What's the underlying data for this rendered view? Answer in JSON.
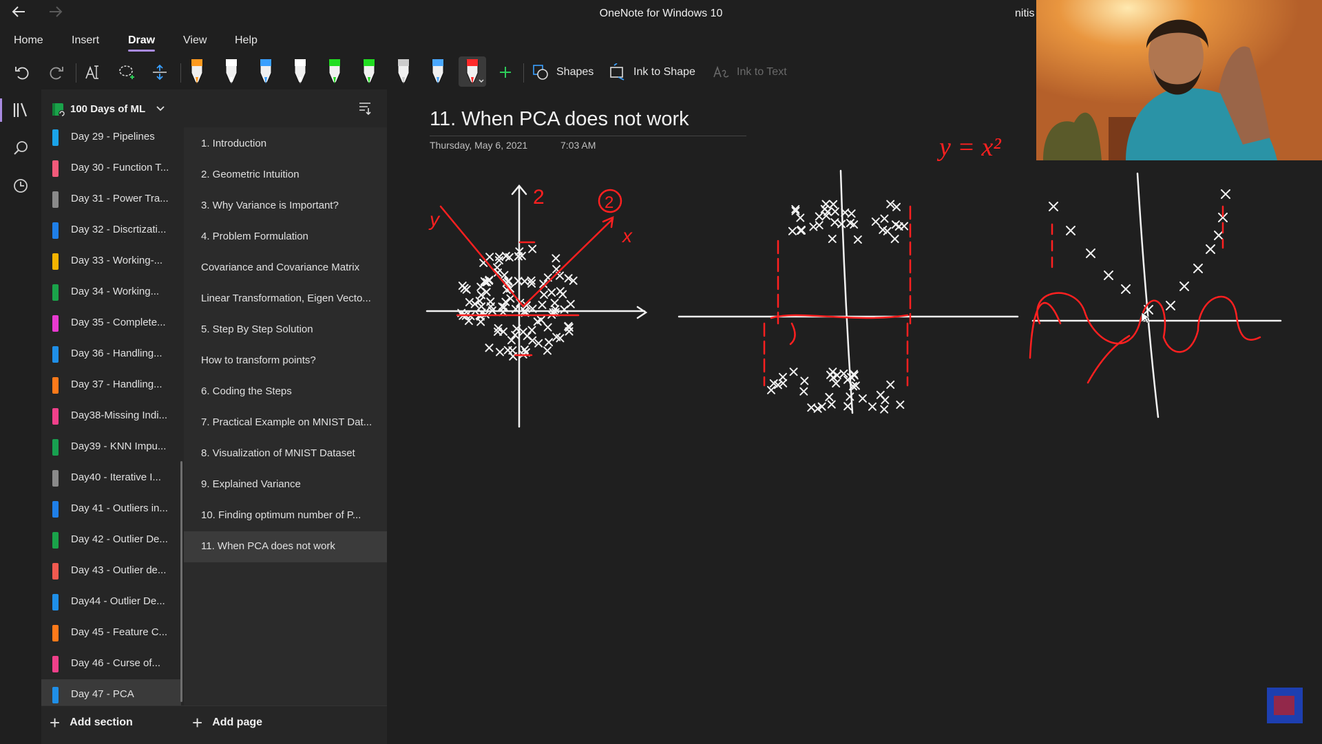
{
  "window": {
    "title": "OneNote for Windows 10",
    "user": "nitis"
  },
  "ribbon": {
    "tabs": [
      {
        "label": "Home"
      },
      {
        "label": "Insert"
      },
      {
        "label": "Draw",
        "active": true
      },
      {
        "label": "View"
      },
      {
        "label": "Help"
      }
    ],
    "pens": [
      {
        "color": "#ff9a1f",
        "icon": "highlighter-icon"
      },
      {
        "color": "#ffffff",
        "icon": "pen-icon"
      },
      {
        "color": "#3aa0ff",
        "icon": "pen-icon"
      },
      {
        "color": "#ffffff",
        "icon": "pencil-icon"
      },
      {
        "color": "#22dd22",
        "icon": "highlighter-icon"
      },
      {
        "color": "#22dd22",
        "icon": "pen-icon"
      },
      {
        "color": "#cccccc",
        "icon": "pencil-icon"
      },
      {
        "color": "#4aa8ff",
        "icon": "pen-icon"
      },
      {
        "color": "#ff2a2a",
        "icon": "pen-icon",
        "selected": true
      }
    ],
    "shapes_label": "Shapes",
    "ink_to_shape_label": "Ink to Shape",
    "ink_to_text_label": "Ink to Text"
  },
  "notebook": {
    "name": "100 Days of ML"
  },
  "sections": [
    {
      "label": "Day 29 - Pipelines",
      "color": "#1aa3e8"
    },
    {
      "label": "Day 30 - Function T...",
      "color": "#f25a7a"
    },
    {
      "label": "Day 31 - Power Tra...",
      "color": "#8a8a8a"
    },
    {
      "label": "Day 32 - Discrtizati...",
      "color": "#1f7fe8"
    },
    {
      "label": "Day 33 - Working-...",
      "color": "#f5b400"
    },
    {
      "label": "Day 34 - Working...",
      "color": "#1aa34a"
    },
    {
      "label": "Day 35 - Complete...",
      "color": "#e83ad0"
    },
    {
      "label": "Day 36 - Handling...",
      "color": "#1f8fe8"
    },
    {
      "label": "Day 37 - Handling...",
      "color": "#ff7a1a"
    },
    {
      "label": "Day38-Missing Indi...",
      "color": "#f0408a"
    },
    {
      "label": "Day39 - KNN Impu...",
      "color": "#18a050"
    },
    {
      "label": "Day40 - Iterative I...",
      "color": "#8a8a8a"
    },
    {
      "label": "Day 41 - Outliers in...",
      "color": "#1f7fe8"
    },
    {
      "label": "Day 42 - Outlier De...",
      "color": "#1aa34a"
    },
    {
      "label": "Day 43 - Outlier de...",
      "color": "#f25a50"
    },
    {
      "label": "Day44 - Outlier De...",
      "color": "#1f8fe8"
    },
    {
      "label": "Day 45 - Feature C...",
      "color": "#ff7a1a"
    },
    {
      "label": "Day 46 - Curse of...",
      "color": "#f0408a"
    },
    {
      "label": "Day 47 - PCA",
      "color": "#1f8fe8",
      "selected": true
    }
  ],
  "pages": [
    {
      "label": "1. Introduction"
    },
    {
      "label": "2. Geometric Intuition"
    },
    {
      "label": "3. Why Variance is Important?"
    },
    {
      "label": "4. Problem Formulation"
    },
    {
      "label": "Covariance and Covariance Matrix"
    },
    {
      "label": "Linear Transformation, Eigen Vecto..."
    },
    {
      "label": "5. Step By Step Solution"
    },
    {
      "label": "How to transform points?"
    },
    {
      "label": "6. Coding the Steps"
    },
    {
      "label": "7. Practical Example on MNIST Dat..."
    },
    {
      "label": "8. Visualization of MNIST Dataset"
    },
    {
      "label": "9. Explained Variance"
    },
    {
      "label": "10. Finding optimum number of P..."
    },
    {
      "label": "11. When PCA does not work",
      "selected": true
    }
  ],
  "bottom": {
    "add_section": "Add section",
    "add_page": "Add page"
  },
  "page": {
    "title": "11. When PCA does not work",
    "date": "Thursday, May 6, 2021",
    "time": "7:03 AM"
  },
  "ink": {
    "label_2": "2",
    "label_circled": "2",
    "label_x": "x",
    "label_y": "y",
    "equation": "y = x²"
  }
}
